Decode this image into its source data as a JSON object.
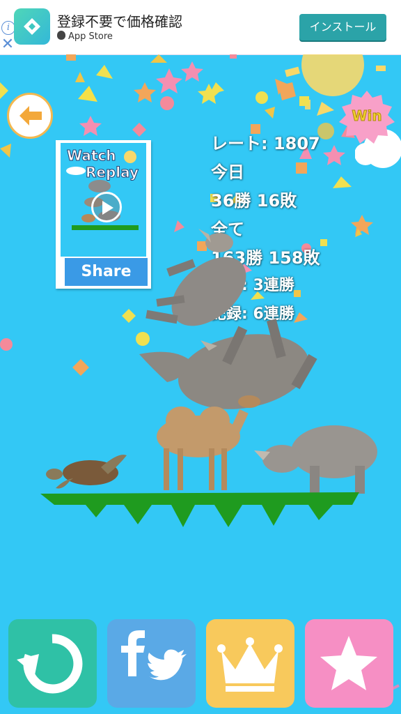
{
  "ad": {
    "title": "登録不要で価格確認",
    "store": "App Store",
    "install_label": "インストール",
    "info_icon": "info-icon",
    "close_icon": "close-icon"
  },
  "replay": {
    "title_line1": "Watch",
    "title_line2": "Replay",
    "share_label": "Share"
  },
  "result": {
    "badge": "Win"
  },
  "stats": {
    "rate": "レート: 1807",
    "today_label": "今日",
    "today_record": "36勝 16敗",
    "all_label": "全て",
    "all_record": "163勝 158敗",
    "current_streak": "現在: 3連勝",
    "best_streak": "記録: 6連勝"
  },
  "stack": [
    "sea-turtle",
    "camel",
    "rhinoceros",
    "rhinoceros",
    "rhinoceros"
  ],
  "toolbar": {
    "buttons": [
      {
        "icon": "retry-icon",
        "color": "#2fc1a6"
      },
      {
        "icon": "facebook-twitter-icon",
        "color": "#5aa9e6"
      },
      {
        "icon": "crown-icon",
        "color": "#f8c95c"
      },
      {
        "icon": "star-icon",
        "color": "#f68fc4"
      }
    ]
  },
  "colors": {
    "sky": "#33c8f5",
    "ground": "#1f9b1f",
    "back_ring": "#f3b850"
  }
}
